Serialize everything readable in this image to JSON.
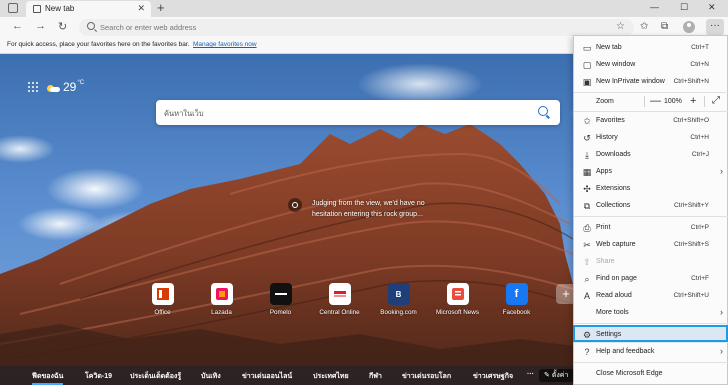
{
  "window": {
    "tab_title": "New tab",
    "new_tab_symbol": "+",
    "minimize": "—",
    "maximize": "☐",
    "close": "✕"
  },
  "toolbar": {
    "address_placeholder": "Search or enter web address"
  },
  "favorites_bar": {
    "message": "For quick access, place your favorites here on the favorites bar.",
    "link": "Manage favorites now"
  },
  "page": {
    "temperature": "29",
    "temp_unit": "°C",
    "search_placeholder": "ค้นหาในเว็บ",
    "caption": "Judging from the view, we'd have no hesitation entering this rock group...",
    "tiles": [
      {
        "label": "Office",
        "icon": "office-icon",
        "color": "#d83b01"
      },
      {
        "label": "Lazada",
        "icon": "lazada-icon",
        "color": "#f0135f"
      },
      {
        "label": "Pomelo",
        "icon": "pomelo-icon",
        "color": "#111111"
      },
      {
        "label": "Central Online",
        "icon": "central-icon",
        "color": "#e01e2b"
      },
      {
        "label": "Booking.com",
        "icon": "booking-icon",
        "color": "#1e3f7a"
      },
      {
        "label": "Microsoft News",
        "icon": "news-icon",
        "color": "#e74c3c"
      },
      {
        "label": "Facebook",
        "icon": "facebook-icon",
        "color": "#1877f2"
      }
    ],
    "news_tabs": [
      "ฟีดของฉัน",
      "โควิด-19",
      "ประเด็นเด็ดต้องรู้",
      "บันเทิง",
      "ข่าวเด่นออนไลน์",
      "ประเทศไทย",
      "กีฬา",
      "ข่าวเด่นรอบโลก",
      "ข่าวเศรษฐกิจ"
    ],
    "news_more": "···",
    "personalize": "ตั้งค่า"
  },
  "menu": {
    "items": [
      {
        "label": "New tab",
        "shortcut": "Ctrl+T",
        "icon": "new-tab-icon"
      },
      {
        "label": "New window",
        "shortcut": "Ctrl+N",
        "icon": "new-window-icon"
      },
      {
        "label": "New InPrivate window",
        "shortcut": "Ctrl+Shift+N",
        "icon": "inprivate-icon"
      },
      {
        "label": "Favorites",
        "shortcut": "Ctrl+Shift+O",
        "icon": "favorites-icon"
      },
      {
        "label": "History",
        "shortcut": "Ctrl+H",
        "icon": "history-icon"
      },
      {
        "label": "Downloads",
        "shortcut": "Ctrl+J",
        "icon": "downloads-icon"
      },
      {
        "label": "Apps",
        "shortcut": "",
        "icon": "apps-icon"
      },
      {
        "label": "Extensions",
        "shortcut": "",
        "icon": "extensions-icon"
      },
      {
        "label": "Collections",
        "shortcut": "Ctrl+Shift+Y",
        "icon": "collections-icon"
      },
      {
        "label": "Print",
        "shortcut": "Ctrl+P",
        "icon": "print-icon"
      },
      {
        "label": "Web capture",
        "shortcut": "Ctrl+Shift+S",
        "icon": "web-capture-icon"
      },
      {
        "label": "Share",
        "shortcut": "",
        "icon": "share-icon"
      },
      {
        "label": "Find on page",
        "shortcut": "Ctrl+F",
        "icon": "find-icon"
      },
      {
        "label": "Read aloud",
        "shortcut": "Ctrl+Shift+U",
        "icon": "read-aloud-icon"
      },
      {
        "label": "More tools",
        "shortcut": "",
        "icon": ""
      },
      {
        "label": "Settings",
        "shortcut": "",
        "icon": "settings-icon"
      },
      {
        "label": "Help and feedback",
        "shortcut": "",
        "icon": "help-icon"
      },
      {
        "label": "Close Microsoft Edge",
        "shortcut": "",
        "icon": ""
      }
    ],
    "zoom_label": "Zoom",
    "zoom_value": "100%",
    "zoom_minus": "—",
    "zoom_plus": "+"
  }
}
